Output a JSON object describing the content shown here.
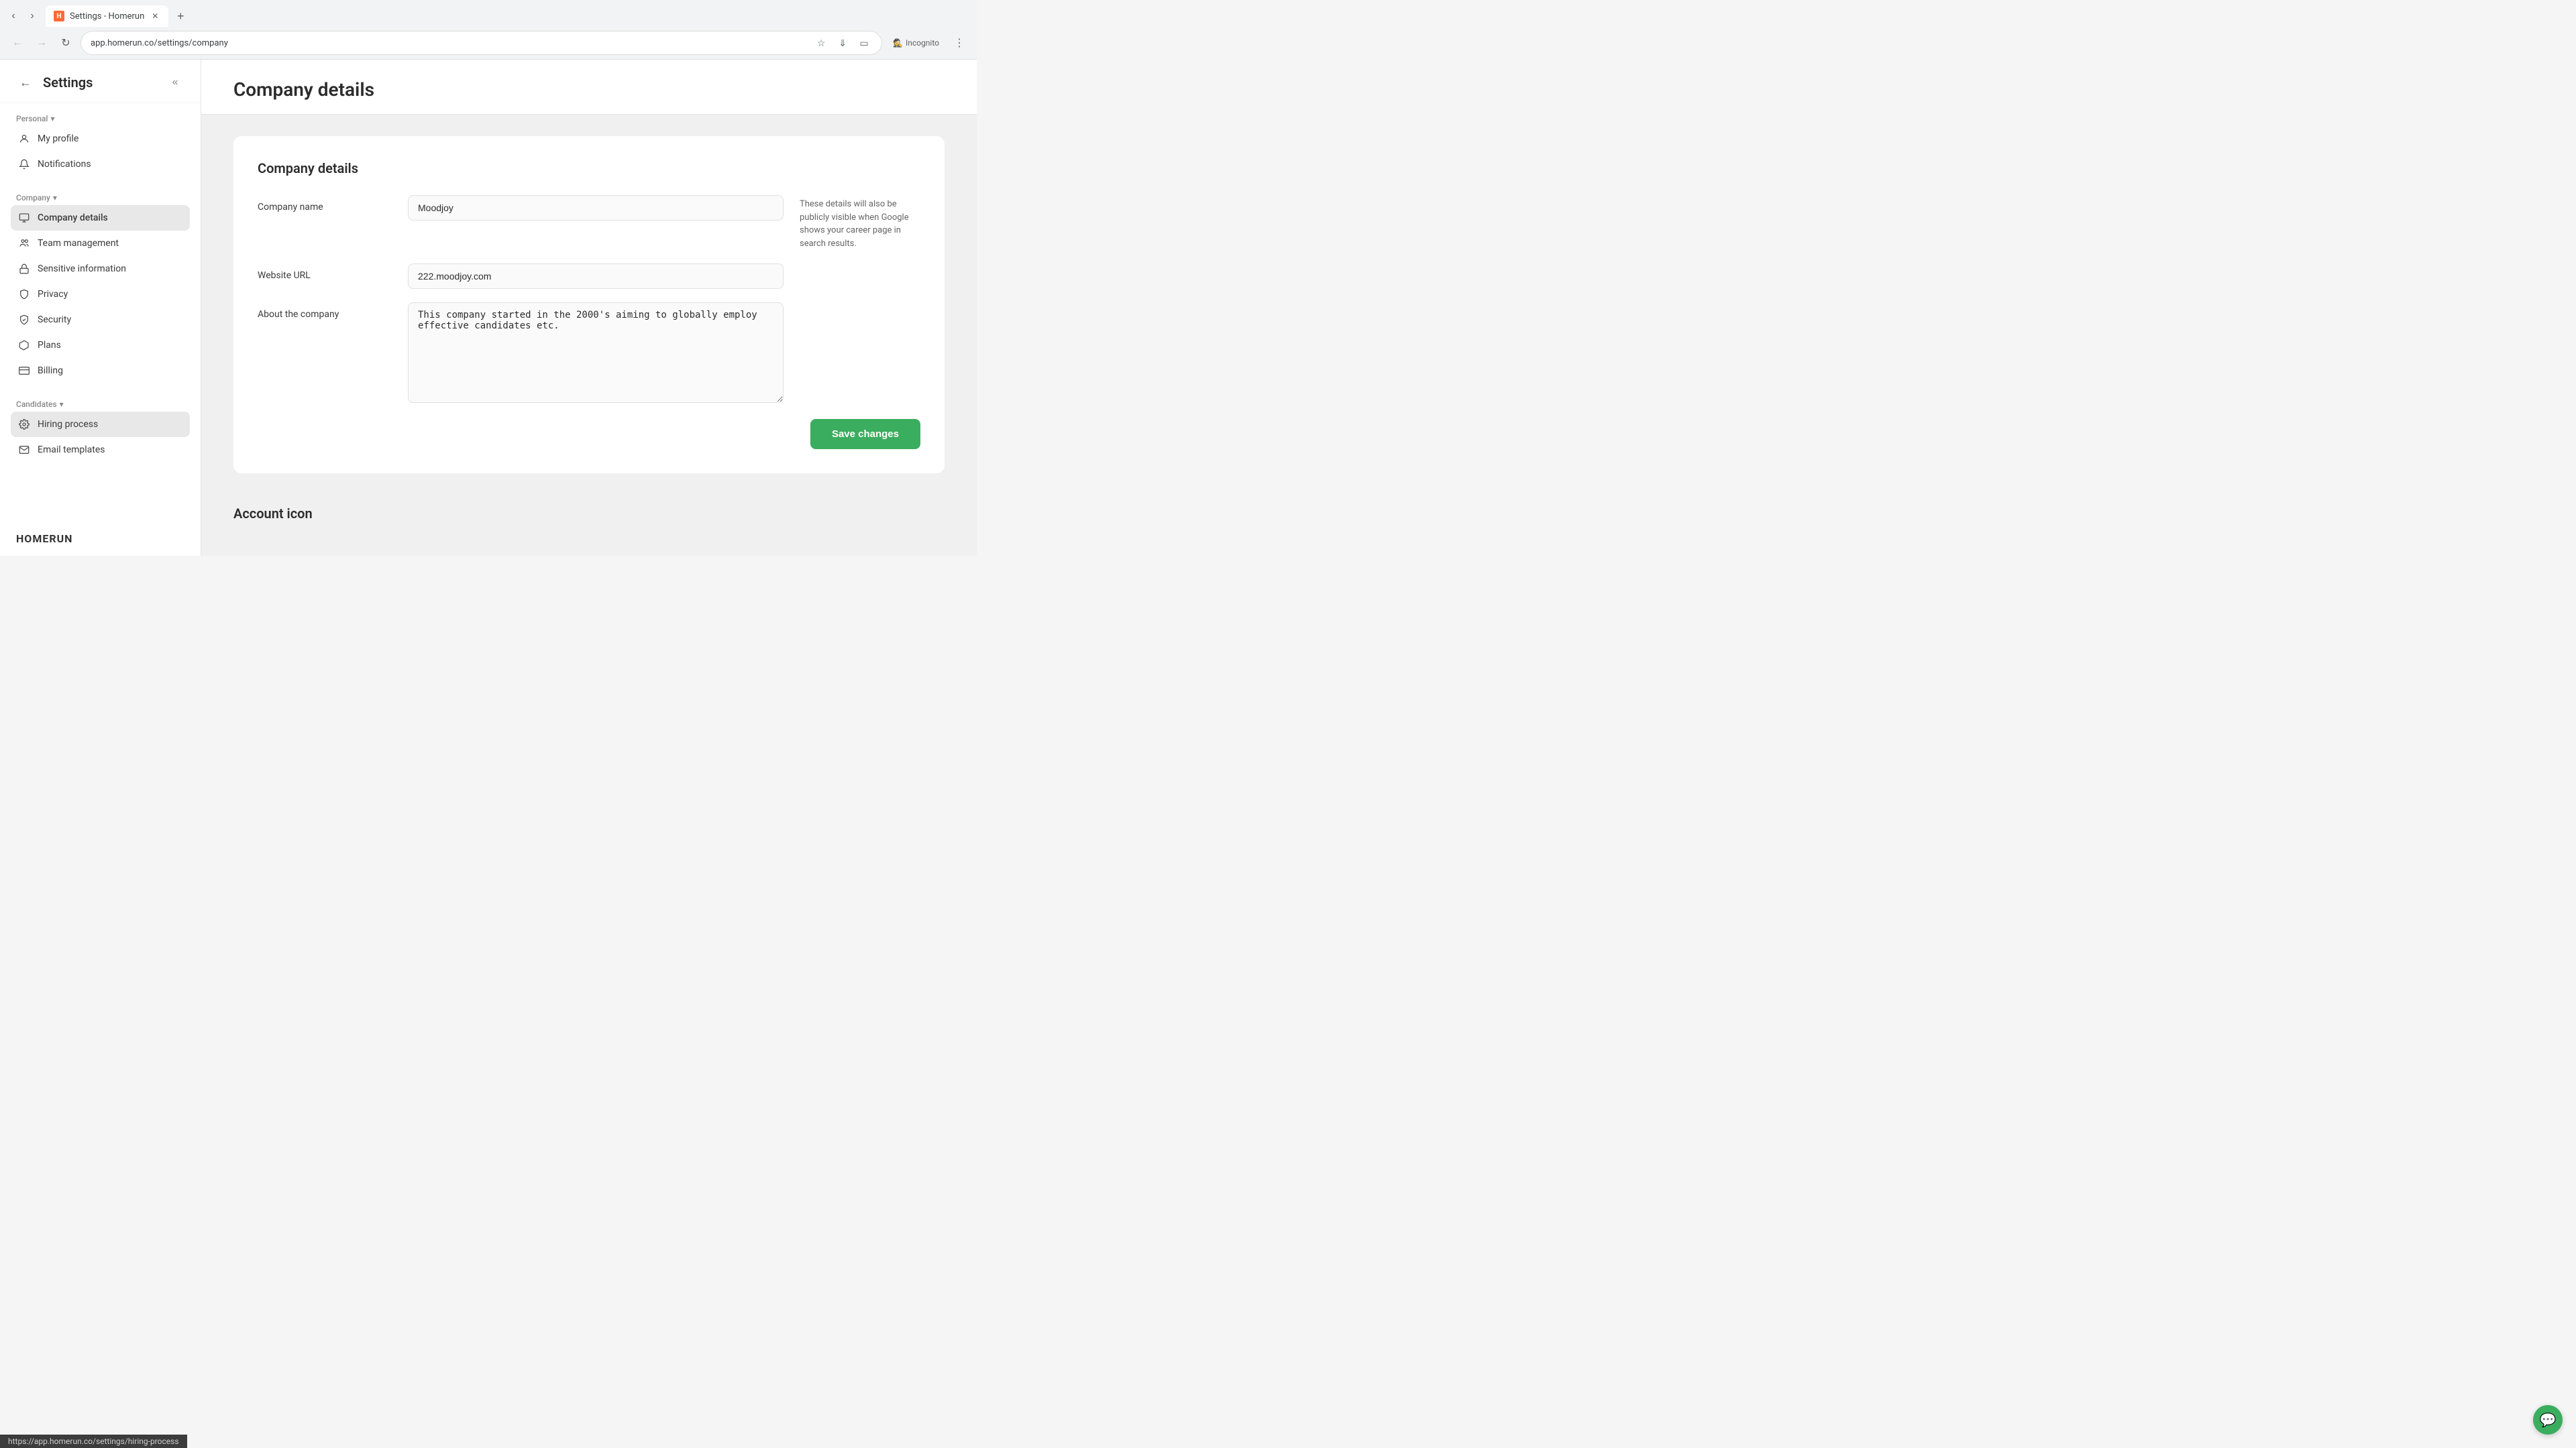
{
  "browser": {
    "tab_favicon": "H",
    "tab_title": "Settings - Homerun",
    "url": "app.homerun.co/settings/company",
    "incognito_label": "Incognito"
  },
  "sidebar": {
    "title": "Settings",
    "back_label": "←",
    "collapse_label": "«",
    "personal_section_label": "Personal",
    "personal_dropdown_icon": "▾",
    "items_personal": [
      {
        "id": "my-profile",
        "label": "My profile",
        "icon": "person"
      },
      {
        "id": "notifications",
        "label": "Notifications",
        "icon": "bell"
      }
    ],
    "company_section_label": "Company",
    "company_dropdown_icon": "▾",
    "items_company": [
      {
        "id": "company-details",
        "label": "Company details",
        "icon": "building",
        "active": true
      },
      {
        "id": "team-management",
        "label": "Team management",
        "icon": "people"
      },
      {
        "id": "sensitive-information",
        "label": "Sensitive information",
        "icon": "lock"
      },
      {
        "id": "privacy",
        "label": "Privacy",
        "icon": "shield"
      },
      {
        "id": "security",
        "label": "Security",
        "icon": "shield-lock"
      },
      {
        "id": "plans",
        "label": "Plans",
        "icon": "box"
      },
      {
        "id": "billing",
        "label": "Billing",
        "icon": "credit-card"
      }
    ],
    "candidates_section_label": "Candidates",
    "candidates_dropdown_icon": "▾",
    "items_candidates": [
      {
        "id": "hiring-process",
        "label": "Hiring process",
        "icon": "gear",
        "hover": true
      },
      {
        "id": "email-templates",
        "label": "Email templates",
        "icon": "envelope"
      }
    ],
    "logo": "HOMERUN"
  },
  "main": {
    "page_title": "Company details",
    "card_title": "Company details",
    "fields": [
      {
        "label": "Company name",
        "type": "input",
        "value": "Moodjoy",
        "placeholder": ""
      },
      {
        "label": "Website URL",
        "type": "input",
        "value": "222.moodjoy.com",
        "placeholder": ""
      },
      {
        "label": "About the company",
        "type": "textarea",
        "value": "This company started in the 2000's aiming to globally employ effective candidates etc.",
        "placeholder": ""
      }
    ],
    "hint_text": "These details will also be publicly visible when Google shows your career page in search results.",
    "save_button_label": "Save changes",
    "account_icon_label": "Account icon"
  },
  "status_bar": {
    "url": "https://app.homerun.co/settings/hiring-process"
  },
  "chat": {
    "icon": "💬"
  }
}
